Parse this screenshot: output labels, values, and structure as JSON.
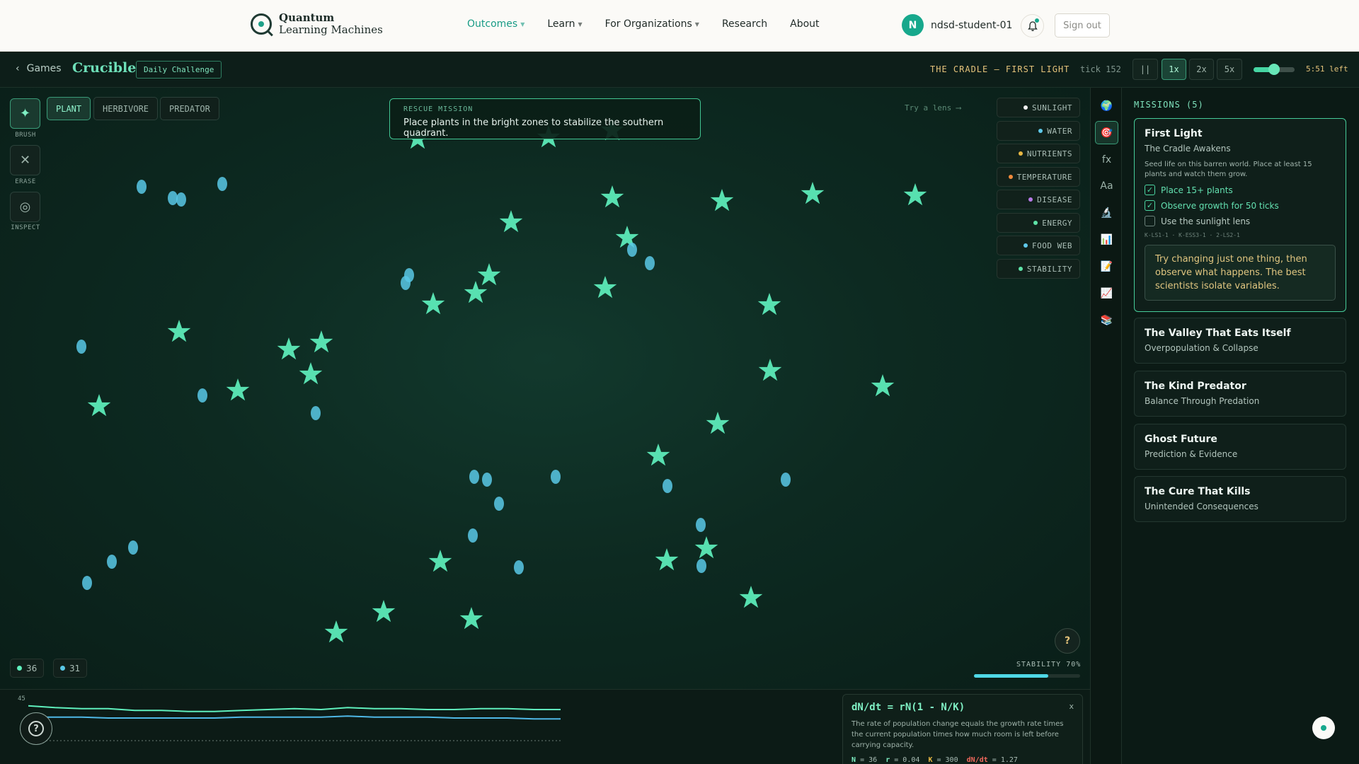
{
  "nav": {
    "brand_line1": "Quantum",
    "brand_line2": "Learning Machines",
    "links": [
      "Outcomes",
      "Learn",
      "For Organizations",
      "Research",
      "About"
    ],
    "user_initial": "N",
    "username": "ndsd-student-01",
    "signout": "Sign out"
  },
  "gamebar": {
    "back": "Games",
    "title": "Crucible",
    "badge": "Daily Challenge",
    "scenario": "THE CRADLE — FIRST LIGHT",
    "tick": "tick 152",
    "pause": "||",
    "speeds": [
      "1x",
      "2x",
      "5x"
    ],
    "speed_slider_level": 0.5,
    "time_left": "5:51 left"
  },
  "tools": {
    "brush": "BRUSH",
    "erase": "ERASE",
    "inspect": "INSPECT"
  },
  "species": [
    "PLANT",
    "HERBIVORE",
    "PREDATOR"
  ],
  "mission_banner": {
    "kicker": "RESCUE MISSION",
    "text": "Place plants in the bright zones to stabilize the southern quadrant."
  },
  "try_lens": "Try a lens",
  "lenses": [
    {
      "label": "SUNLIGHT",
      "color": "#f2f2f2"
    },
    {
      "label": "WATER",
      "color": "#5fc9ea"
    },
    {
      "label": "NUTRIENTS",
      "color": "#e8b843"
    },
    {
      "label": "TEMPERATURE",
      "color": "#f08a3c"
    },
    {
      "label": "DISEASE",
      "color": "#b77ae8"
    },
    {
      "label": "ENERGY",
      "color": "#5ee3a8"
    },
    {
      "label": "FOOD WEB",
      "color": "#5fc9ea"
    },
    {
      "label": "STABILITY",
      "color": "#5ee3a8"
    }
  ],
  "help": "?",
  "stability": {
    "label": "STABILITY 70%",
    "value": 0.7
  },
  "counts": {
    "plants": "36",
    "herbivores": "31"
  },
  "graph": {
    "ymax": "45",
    "help": "?",
    "series_plants": [
      40,
      38,
      37,
      37,
      35,
      35,
      34,
      34,
      35,
      36,
      37,
      36,
      38,
      37,
      37,
      36,
      36,
      37,
      37,
      36,
      36
    ],
    "series_herbivores": [
      28,
      28,
      28,
      27,
      27,
      27,
      27,
      27,
      28,
      28,
      28,
      28,
      29,
      28,
      28,
      28,
      27,
      27,
      27,
      26,
      26
    ]
  },
  "formula": {
    "equation": "dN/dt = rN(1 - N/K)",
    "close": "x",
    "description": "The rate of population change equals the growth rate times the current population times how much room is left before carrying capacity.",
    "vars": [
      {
        "k": "N",
        "v": "= 36"
      },
      {
        "k": "r",
        "v": "= 0.04"
      },
      {
        "k": "K",
        "v": "= 300"
      },
      {
        "k": "dN/dt",
        "v": "= 1.27"
      }
    ]
  },
  "rail_icons": [
    "🌍",
    "🎯",
    "fx",
    "Aa",
    "🔬",
    "📊",
    "📝",
    "📈",
    "📚"
  ],
  "missions": {
    "title": "MISSIONS (5)",
    "active": {
      "name": "First Light",
      "subtitle": "The Cradle Awakens",
      "description": "Seed life on this barren world. Place at least 15 plants and watch them grow.",
      "checklist": [
        {
          "label": "Place 15+ plants",
          "done": true
        },
        {
          "label": "Observe growth for 50 ticks",
          "done": true
        },
        {
          "label": "Use the sunlight lens",
          "done": false
        }
      ],
      "standards": "K-LS1-1 · K-ESS3-1 · 2-LS2-1",
      "hint": "Try changing just one thing, then observe what happens. The best scientists isolate variables."
    },
    "others": [
      {
        "name": "The Valley That Eats Itself",
        "subtitle": "Overpopulation & Collapse"
      },
      {
        "name": "The Kind Predator",
        "subtitle": "Balance Through Predation"
      },
      {
        "name": "Ghost Future",
        "subtitle": "Prediction & Evidence"
      },
      {
        "name": "The Cure That Kills",
        "subtitle": "Unintended Consequences"
      }
    ]
  }
}
